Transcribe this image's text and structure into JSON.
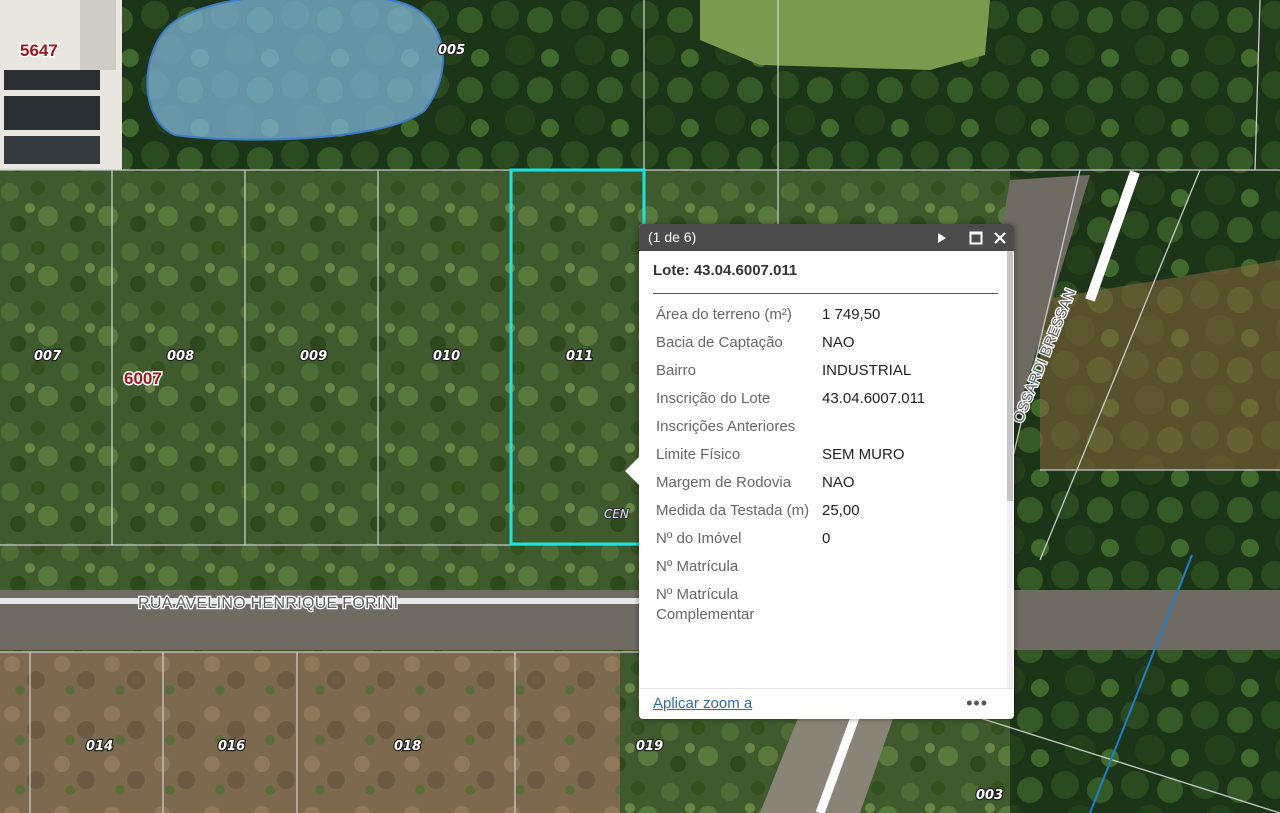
{
  "map": {
    "block_labels": [
      "5647",
      "6007"
    ],
    "lot_labels": [
      "005",
      "007",
      "008",
      "009",
      "010",
      "011",
      "014",
      "016",
      "018",
      "019",
      "003"
    ],
    "street_labels": [
      "RUA AVELINO HENRIQUE FORINI",
      "OSSARDI BRESSAN"
    ],
    "partial_label": "CEN"
  },
  "popup": {
    "counter": "(1 de 6)",
    "title": "Lote: 43.04.6007.011",
    "fields": [
      {
        "k": "Área do terreno (m²)",
        "v": "1 749,50"
      },
      {
        "k": "Bacia de Captação",
        "v": "NAO"
      },
      {
        "k": "Bairro",
        "v": "INDUSTRIAL"
      },
      {
        "k": "Inscrição do Lote",
        "v": "43.04.6007.011"
      },
      {
        "k": "Inscrições Anteriores",
        "v": ""
      },
      {
        "k": "Limite Físico",
        "v": "SEM MURO"
      },
      {
        "k": "Margem de Rodovia",
        "v": "NAO"
      },
      {
        "k": "Medida da Testada (m)",
        "v": "25,00"
      },
      {
        "k": "Nº do Imóvel",
        "v": "0"
      },
      {
        "k": "Nº Matrícula",
        "v": ""
      },
      {
        "k": "Nº Matrícula Complementar",
        "v": ""
      }
    ],
    "zoom_link": "Aplicar zoom a",
    "more": "•••",
    "icons": [
      "play-icon",
      "maximize-icon",
      "close-icon"
    ]
  },
  "colors": {
    "selected_parcel": "#1fe3e3",
    "header_bg": "#4b4b4b",
    "block_label": "#a0151a",
    "water": "#7fb4d8"
  }
}
